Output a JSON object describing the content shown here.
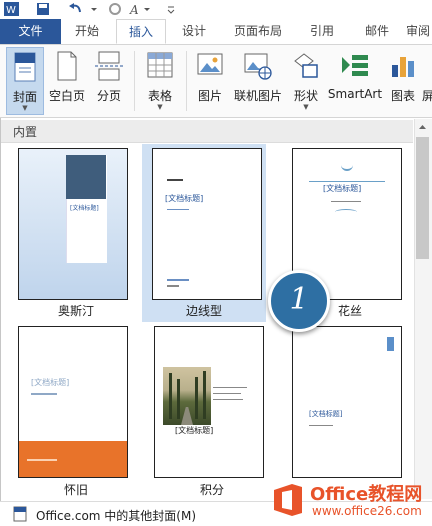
{
  "ribbon_tabs": [
    "文件",
    "开始",
    "插入",
    "设计",
    "页面布局",
    "引用",
    "邮件",
    "审阅"
  ],
  "active_tab": "插入",
  "ribbon": {
    "cover": "封面",
    "blank_page": "空白页",
    "page_break": "分页",
    "table": "表格",
    "picture": "图片",
    "online_picture": "联机图片",
    "shapes": "形状",
    "smartart": "SmartArt",
    "chart": "图表",
    "screenshot_partial": "屏"
  },
  "gallery": {
    "section_title": "内置",
    "items": [
      {
        "name": "奥斯汀",
        "title_text": "[文档标题]"
      },
      {
        "name": "边线型",
        "title_text": "[文档标题]"
      },
      {
        "name": "花丝",
        "title_text": "[文档标题]"
      },
      {
        "name": "怀旧",
        "title_text": "[文档标题]"
      },
      {
        "name": "积分",
        "title_text": "[文档标题]"
      },
      {
        "name": "",
        "title_text": "[文档标题]"
      }
    ],
    "selected": "边线型"
  },
  "callout_number": "1",
  "footer": {
    "more_covers": "Office.com 中的其他封面(M)"
  },
  "watermark": {
    "brand": "Office教程网",
    "url": "www.office26.com"
  },
  "colors": {
    "accent": "#2b579a",
    "selected_bg": "#cfe0f3",
    "callout": "#2e6fa3",
    "orange": "#e8732a"
  }
}
